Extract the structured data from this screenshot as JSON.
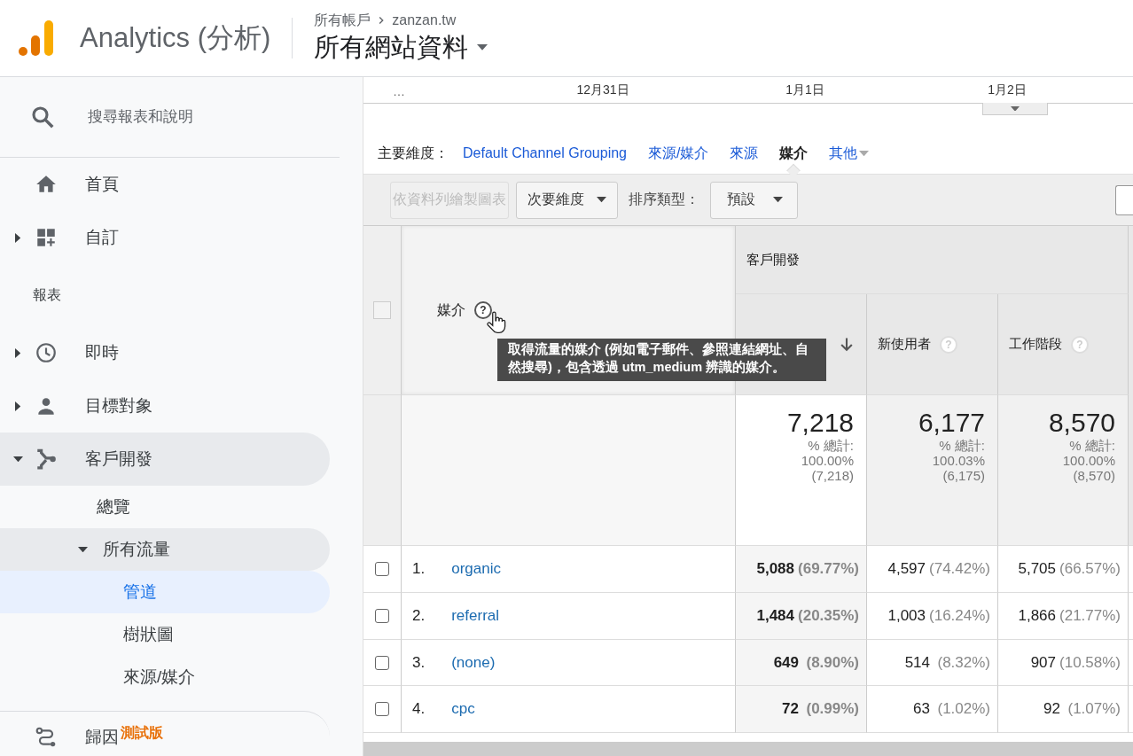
{
  "header": {
    "product": "Analytics (分析)",
    "breadcrumb": {
      "account": "所有帳戶",
      "property": "zanzan.tw"
    },
    "view": "所有網站資料"
  },
  "sidebar": {
    "search": {
      "placeholder": "搜尋報表和說明"
    },
    "items": [
      {
        "kind": "nav",
        "label": "首頁"
      },
      {
        "kind": "nav",
        "label": "自訂",
        "expanded": false
      },
      {
        "kind": "section",
        "label": "報表"
      },
      {
        "kind": "nav",
        "label": "即時",
        "expanded": false
      },
      {
        "kind": "nav",
        "label": "目標對象",
        "expanded": false
      },
      {
        "kind": "nav",
        "label": "客戶開發",
        "expanded": true,
        "children": [
          {
            "label": "總覽",
            "selected": false
          },
          {
            "label": "所有流量",
            "expanded": true,
            "children": [
              {
                "label": "管道",
                "selected": true
              },
              {
                "label": "樹狀圖",
                "selected": false
              },
              {
                "label": "來源/媒介",
                "selected": false
              }
            ]
          }
        ]
      },
      {
        "kind": "footer",
        "label": "歸因",
        "badge": "測試版"
      }
    ]
  },
  "report": {
    "timeline": {
      "labels": [
        "…",
        "12月31日",
        "1月1日",
        "1月2日"
      ]
    },
    "dimensions": {
      "label": "主要維度：",
      "options": [
        {
          "label": "Default Channel Grouping",
          "selected": false,
          "kind": "link"
        },
        {
          "label": "來源/媒介",
          "selected": false,
          "kind": "link"
        },
        {
          "label": "來源",
          "selected": false,
          "kind": "link"
        },
        {
          "label": "媒介",
          "selected": true,
          "kind": "link"
        },
        {
          "label": "其他",
          "selected": false,
          "kind": "menu"
        }
      ]
    },
    "toolbar": {
      "plot_button": {
        "label": "依資料列繪製圖表",
        "disabled": true
      },
      "secondary_dimension": "次要維度",
      "sort_label": "排序類型：",
      "sort_value": "預設"
    },
    "table": {
      "all_checked": false,
      "dimension_header": "媒介",
      "dimension_help": "?",
      "group_header": "客戶開發",
      "columns": [
        {
          "sorted": true
        },
        {
          "label": "新使用者",
          "help": "?",
          "sorted": false
        },
        {
          "label": "工作階段",
          "help": "?",
          "sorted": false
        }
      ],
      "totals": [
        {
          "value": "7,218",
          "caption": "% 總計:",
          "percent": "100.00%",
          "count": "(7,218)"
        },
        {
          "value": "6,177",
          "caption": "% 總計:",
          "percent": "100.03%",
          "count": "(6,175)"
        },
        {
          "value": "8,570",
          "caption": "% 總計:",
          "percent": "100.00%",
          "count": "(8,570)"
        }
      ],
      "rows": [
        {
          "index": "1.",
          "name": "organic",
          "checked": false,
          "cells": [
            {
              "value": "5,088",
              "percent": "(69.77%)"
            },
            {
              "value": "4,597",
              "percent": "(74.42%)"
            },
            {
              "value": "5,705",
              "percent": "(66.57%)"
            }
          ]
        },
        {
          "index": "2.",
          "name": "referral",
          "checked": false,
          "cells": [
            {
              "value": "1,484",
              "percent": "(20.35%)"
            },
            {
              "value": "1,003",
              "percent": "(16.24%)"
            },
            {
              "value": "1,866",
              "percent": "(21.77%)"
            }
          ]
        },
        {
          "index": "3.",
          "name": "(none)",
          "checked": false,
          "cells": [
            {
              "value": "649",
              "percent": "(8.90%)"
            },
            {
              "value": "514",
              "percent": "(8.32%)"
            },
            {
              "value": "907",
              "percent": "(10.58%)"
            }
          ]
        },
        {
          "index": "4.",
          "name": "cpc",
          "checked": false,
          "cells": [
            {
              "value": "72",
              "percent": "(0.99%)"
            },
            {
              "value": "63",
              "percent": "(1.02%)"
            },
            {
              "value": "92",
              "percent": "(1.07%)"
            }
          ]
        }
      ]
    },
    "tooltip": {
      "text": "取得流量的媒介 (例如電子郵件、參照連結網址、自然搜尋)，包含透過 utm_medium 辨識的媒介。"
    }
  }
}
